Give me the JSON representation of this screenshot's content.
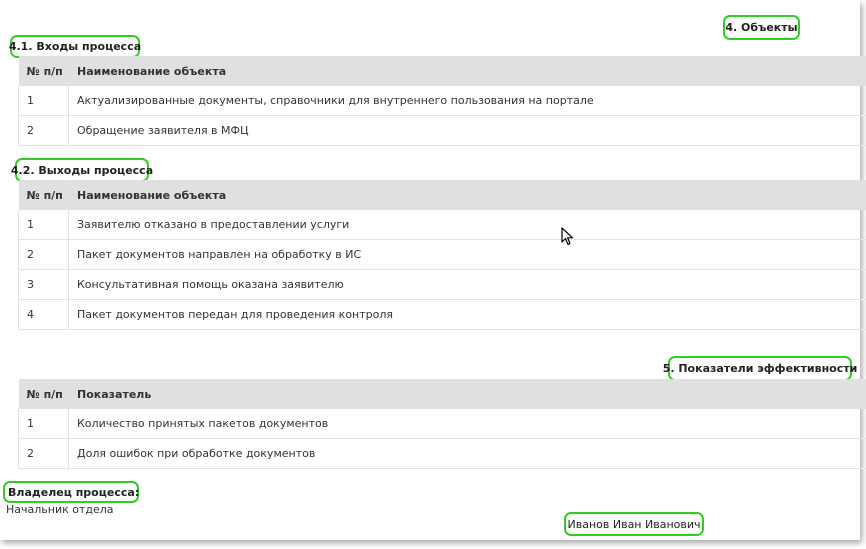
{
  "headings": {
    "objects": "4. Объекты",
    "inputs": "4.1. Входы процесса",
    "outputs": "4.2. Выходы процесса",
    "kpi": "5. Показатели эффективности",
    "owner": "Владелец процесса:"
  },
  "inputs_table": {
    "col_num": "№ п/п",
    "col_name": "Наименование объекта",
    "rows": [
      {
        "num": "1",
        "name": "Актуализированные документы, справочники для внутреннего пользования на портале"
      },
      {
        "num": "2",
        "name": "Обращение заявителя в МФЦ"
      }
    ]
  },
  "outputs_table": {
    "col_num": "№ п/п",
    "col_name": "Наименование объекта",
    "rows": [
      {
        "num": "1",
        "name": "Заявителю отказано в предоставлении услуги"
      },
      {
        "num": "2",
        "name": "Пакет документов направлен на обработку в ИС"
      },
      {
        "num": "3",
        "name": "Консультативная помощь оказана заявителю"
      },
      {
        "num": "4",
        "name": "Пакет документов передан для проведения контроля"
      }
    ]
  },
  "kpi_table": {
    "col_num": "№ п/п",
    "col_name": "Показатель",
    "rows": [
      {
        "num": "1",
        "name": "Количество принятых пакетов документов"
      },
      {
        "num": "2",
        "name": "Доля ошибок при обработке документов"
      }
    ]
  },
  "owner": {
    "position": "Начальник отдела",
    "name": "Иванов Иван Иванович"
  },
  "colors": {
    "highlight": "#33cc22",
    "header_bg": "#e0e0e0"
  }
}
